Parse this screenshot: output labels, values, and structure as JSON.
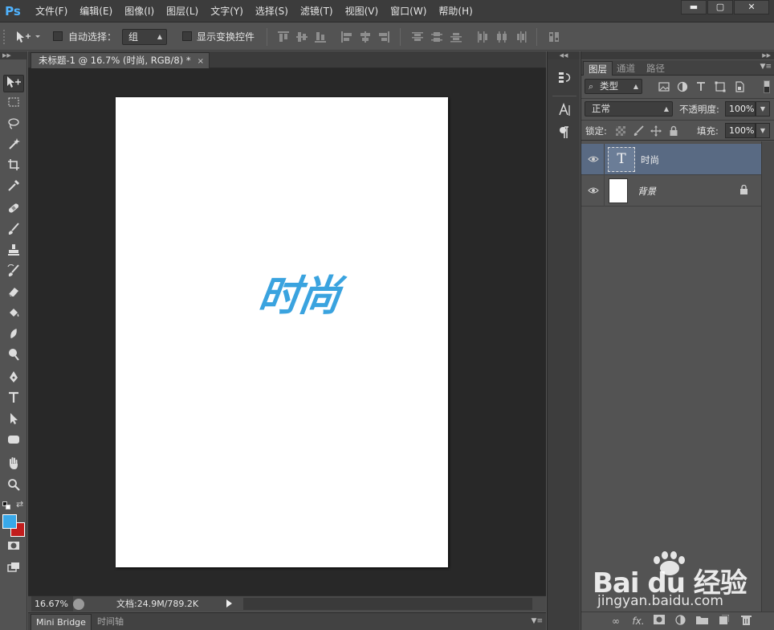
{
  "app": {
    "logo": "Ps"
  },
  "menu": [
    "文件(F)",
    "编辑(E)",
    "图像(I)",
    "图层(L)",
    "文字(Y)",
    "选择(S)",
    "滤镜(T)",
    "视图(V)",
    "窗口(W)",
    "帮助(H)"
  ],
  "window_controls": {
    "minimize": "▬",
    "maximize": "▢",
    "close": "✕"
  },
  "options_bar": {
    "auto_select_label": "自动选择：",
    "auto_select_checked": false,
    "auto_select_value": "组",
    "show_transform_label": "显示变换控件",
    "show_transform_checked": false
  },
  "document": {
    "tab_title": "未标题-1 @ 16.7% (时尚, RGB/8) *",
    "tab_close": "×",
    "canvas_text": "时尚",
    "text_color": "#3aa3df"
  },
  "status": {
    "zoom": "16.67%",
    "doc_size": "文档:24.9M/789.2K"
  },
  "bottom_panel": {
    "tabs": [
      "Mini Bridge",
      "时间轴"
    ]
  },
  "colors": {
    "foreground": "#39a8e8",
    "background": "#c21d1d",
    "selected_layer": "#596a83"
  },
  "layers_panel": {
    "tabs": [
      "图层",
      "通道",
      "路径"
    ],
    "filter_label": "类型",
    "blend_mode": "正常",
    "opacity_label": "不透明度:",
    "opacity_value": "100%",
    "lock_label": "锁定:",
    "fill_label": "填充:",
    "fill_value": "100%",
    "layers": [
      {
        "name": "时尚",
        "type": "text",
        "selected": true,
        "visible": true
      },
      {
        "name": "背景",
        "type": "background",
        "selected": false,
        "visible": true,
        "locked": true
      }
    ]
  },
  "watermark": {
    "brand": "Bai du 经验",
    "url": "jingyan.baidu.com"
  }
}
